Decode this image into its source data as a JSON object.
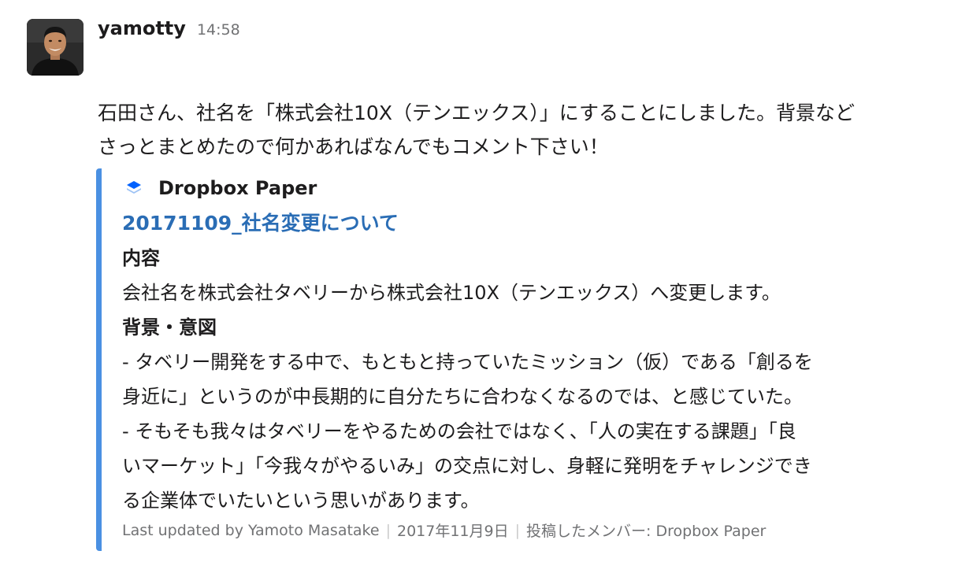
{
  "message": {
    "username": "yamotty",
    "timestamp": "14:58",
    "text_line1": "石田さん、社名を「株式会社10X（テンエックス）」にすることにしました。背景など",
    "text_line2": "さっとまとめたので何かあればなんでもコメント下さい！"
  },
  "attachment": {
    "accent_color": "#4a90e2",
    "service_icon": "dropbox-paper-icon",
    "service_name": "Dropbox Paper",
    "title": "20171109_社名変更について",
    "section1_heading": "内容",
    "section1_text": "会社名を株式会社タベリーから株式会社10X（テンエックス）へ変更します。",
    "section2_heading": "背景・意図",
    "section2_line1": "- タベリー開発をする中で、もともと持っていたミッション（仮）である「創るを",
    "section2_line2": "身近に」というのが中長期的に自分たちに合わなくなるのでは、と感じていた。",
    "section2_line3": "- そもそも我々はタベリーをやるための会社ではなく、「人の実在する課題」「良",
    "section2_line4": "いマーケット」「今我々がやるいみ」の交点に対し、身軽に発明をチャレンジでき",
    "section2_line5": "る企業体でいたいという思いがあります。",
    "footer_updated": "Last updated by Yamoto Masatake",
    "footer_date": "2017年11月9日",
    "footer_posted": "投稿したメンバー: Dropbox Paper"
  }
}
